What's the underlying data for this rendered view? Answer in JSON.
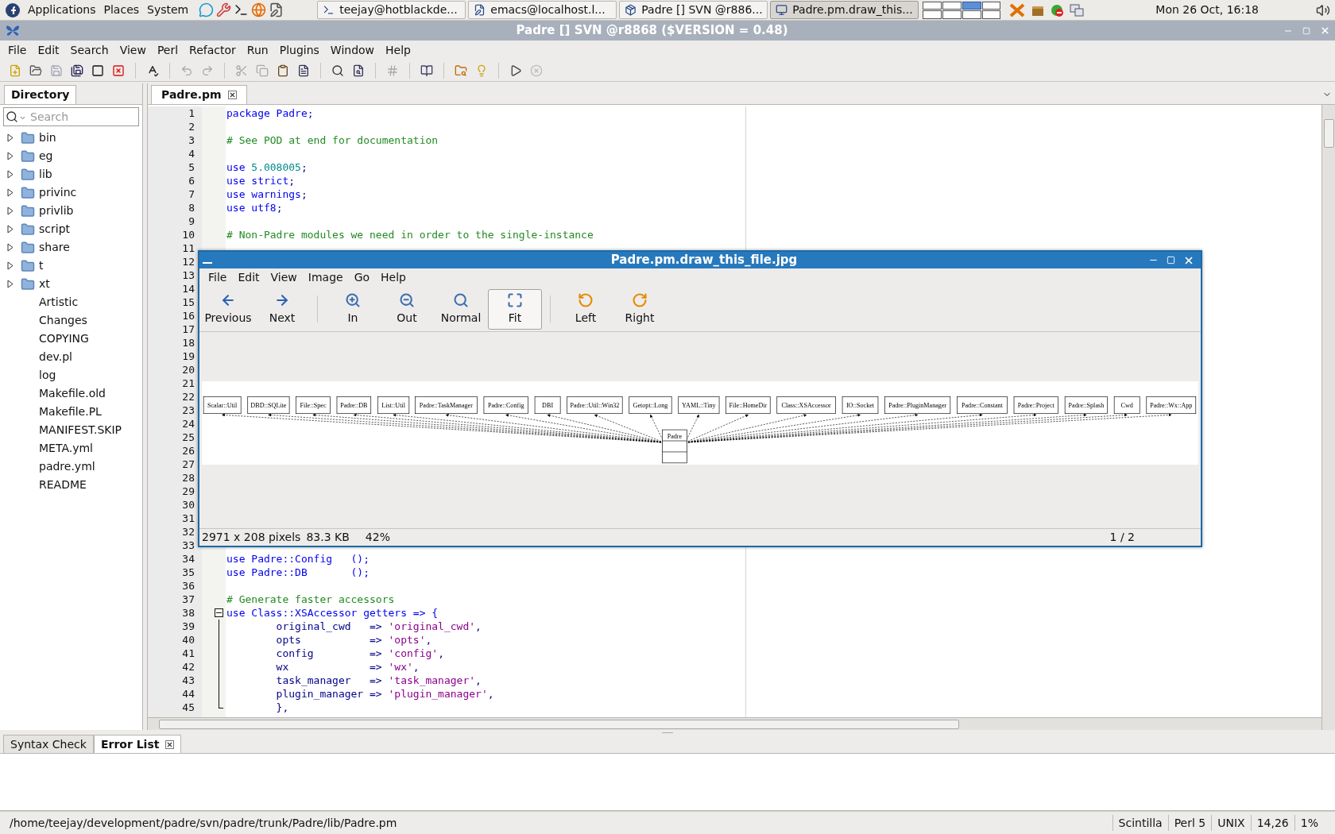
{
  "top_panel": {
    "menus": [
      "Applications",
      "Places",
      "System"
    ],
    "launchers": [
      {
        "kind": "chat"
      },
      {
        "kind": "tools"
      },
      {
        "kind": "terminal"
      },
      {
        "kind": "browser"
      },
      {
        "kind": "editor"
      }
    ],
    "tasks": [
      {
        "label": "teejay@hotblackde...",
        "kind": "terminal",
        "selected": false
      },
      {
        "label": "emacs@localhost.l...",
        "kind": "emacs",
        "selected": false
      },
      {
        "label": "Padre [] SVN @r886...",
        "kind": "padre",
        "selected": false
      },
      {
        "label": "Padre.pm.draw_this...",
        "kind": "viewer",
        "selected": true
      }
    ],
    "workspaces": [
      {
        "selected": false
      },
      {
        "selected": false
      },
      {
        "selected": true
      },
      {
        "selected": false
      },
      {
        "selected": false
      },
      {
        "selected": false
      },
      {
        "selected": false
      },
      {
        "selected": false
      }
    ],
    "clock": "Mon 26 Oct, 16:18"
  },
  "window": {
    "title": "Padre [] SVN @r8868 ($VERSION = 0.48)"
  },
  "menu": [
    "File",
    "Edit",
    "Search",
    "View",
    "Perl",
    "Refactor",
    "Run",
    "Plugins",
    "Window",
    "Help"
  ],
  "toolbar": [
    {
      "kind": "new",
      "disabled": false
    },
    {
      "kind": "open",
      "disabled": false
    },
    {
      "kind": "save",
      "disabled": true
    },
    {
      "kind": "save_as",
      "disabled": false
    },
    {
      "kind": "close_all",
      "disabled": false
    },
    {
      "kind": "close",
      "disabled": false
    },
    {
      "kind": "separator"
    },
    {
      "kind": "spell",
      "disabled": false
    },
    {
      "kind": "separator"
    },
    {
      "kind": "undo",
      "disabled": true
    },
    {
      "kind": "redo",
      "disabled": true
    },
    {
      "kind": "separator"
    },
    {
      "kind": "cut",
      "disabled": true
    },
    {
      "kind": "copy",
      "disabled": true
    },
    {
      "kind": "paste",
      "disabled": false
    },
    {
      "kind": "select_all",
      "disabled": false
    },
    {
      "kind": "separator"
    },
    {
      "kind": "find",
      "disabled": false
    },
    {
      "kind": "replace",
      "disabled": false
    },
    {
      "kind": "separator"
    },
    {
      "kind": "comment",
      "disabled": true
    },
    {
      "kind": "separator"
    },
    {
      "kind": "docs",
      "disabled": false
    },
    {
      "kind": "separator"
    },
    {
      "kind": "resource",
      "disabled": false
    },
    {
      "kind": "tip",
      "disabled": false
    },
    {
      "kind": "separator"
    },
    {
      "kind": "run",
      "disabled": false
    },
    {
      "kind": "stop",
      "disabled": true
    }
  ],
  "sidebar": {
    "tab": "Directory",
    "search": {
      "placeholder": "Search"
    },
    "items": [
      {
        "name": "bin",
        "kind": "folder"
      },
      {
        "name": "eg",
        "kind": "folder"
      },
      {
        "name": "lib",
        "kind": "folder"
      },
      {
        "name": "privinc",
        "kind": "folder"
      },
      {
        "name": "privlib",
        "kind": "folder"
      },
      {
        "name": "script",
        "kind": "folder"
      },
      {
        "name": "share",
        "kind": "folder"
      },
      {
        "name": "t",
        "kind": "folder"
      },
      {
        "name": "xt",
        "kind": "folder"
      },
      {
        "name": "Artistic",
        "kind": "file"
      },
      {
        "name": "Changes",
        "kind": "file"
      },
      {
        "name": "COPYING",
        "kind": "file"
      },
      {
        "name": "dev.pl",
        "kind": "file"
      },
      {
        "name": "log",
        "kind": "file"
      },
      {
        "name": "Makefile.old",
        "kind": "file"
      },
      {
        "name": "Makefile.PL",
        "kind": "file"
      },
      {
        "name": "MANIFEST.SKIP",
        "kind": "file"
      },
      {
        "name": "META.yml",
        "kind": "file"
      },
      {
        "name": "padre.yml",
        "kind": "file"
      },
      {
        "name": "README",
        "kind": "file"
      }
    ]
  },
  "editor": {
    "tabs": [
      {
        "label": "Padre.pm",
        "selected": true
      }
    ],
    "lines": [
      {
        "number": "1",
        "tokens": [
          {
            "kind": "kw",
            "text": "package Padre;"
          }
        ]
      },
      {
        "number": "2"
      },
      {
        "number": "3",
        "tokens": [
          {
            "kind": "comment",
            "text": "# See POD at end for documentation"
          }
        ]
      },
      {
        "number": "4"
      },
      {
        "number": "5",
        "tokens": [
          {
            "kind": "kw",
            "text": "use "
          },
          {
            "kind": "num",
            "text": "5.008005"
          },
          {
            "kind": "plain",
            "text": ";"
          }
        ]
      },
      {
        "number": "6",
        "tokens": [
          {
            "kind": "kw",
            "text": "use strict"
          },
          {
            "kind": "plain",
            "text": ";"
          }
        ]
      },
      {
        "number": "7",
        "tokens": [
          {
            "kind": "kw",
            "text": "use warnings"
          },
          {
            "kind": "plain",
            "text": ";"
          }
        ]
      },
      {
        "number": "8",
        "tokens": [
          {
            "kind": "kw",
            "text": "use utf8"
          },
          {
            "kind": "plain",
            "text": ";"
          }
        ]
      },
      {
        "number": "9"
      },
      {
        "number": "10",
        "tokens": [
          {
            "kind": "comment",
            "text": "# Non-Padre modules we need in order to the single-instance"
          }
        ]
      },
      {
        "number": "11"
      },
      {
        "number": "12"
      },
      {
        "number": "13"
      },
      {
        "number": "14"
      },
      {
        "number": "15"
      },
      {
        "number": "16"
      },
      {
        "number": "17"
      },
      {
        "number": "18"
      },
      {
        "number": "19"
      },
      {
        "number": "20"
      },
      {
        "number": "21"
      },
      {
        "number": "22"
      },
      {
        "number": "23"
      },
      {
        "number": "24"
      },
      {
        "number": "25"
      },
      {
        "number": "26"
      },
      {
        "number": "27"
      },
      {
        "number": "28"
      },
      {
        "number": "29"
      },
      {
        "number": "30"
      },
      {
        "number": "31"
      },
      {
        "number": "32"
      },
      {
        "number": "33"
      },
      {
        "number": "34",
        "tokens": [
          {
            "kind": "kw",
            "text": "use Padre::Config   ();"
          }
        ]
      },
      {
        "number": "35",
        "tokens": [
          {
            "kind": "kw",
            "text": "use Padre::DB       ();"
          }
        ]
      },
      {
        "number": "36"
      },
      {
        "number": "37",
        "tokens": [
          {
            "kind": "comment",
            "text": "# Generate faster accessors"
          }
        ]
      },
      {
        "number": "38",
        "kind": "fold_start",
        "tokens": [
          {
            "kind": "kw",
            "text": "use Class::XSAccessor getters => {"
          }
        ]
      },
      {
        "number": "39",
        "kind": "fold_line",
        "tokens": [
          {
            "kind": "plain",
            "text": "        original_cwd   => "
          },
          {
            "kind": "str",
            "text": "'original_cwd'"
          },
          {
            "kind": "plain",
            "text": ","
          }
        ]
      },
      {
        "number": "40",
        "kind": "fold_line",
        "tokens": [
          {
            "kind": "plain",
            "text": "        opts           => "
          },
          {
            "kind": "str",
            "text": "'opts'"
          },
          {
            "kind": "plain",
            "text": ","
          }
        ]
      },
      {
        "number": "41",
        "kind": "fold_line",
        "tokens": [
          {
            "kind": "plain",
            "text": "        config         => "
          },
          {
            "kind": "str",
            "text": "'config'"
          },
          {
            "kind": "plain",
            "text": ","
          }
        ]
      },
      {
        "number": "42",
        "kind": "fold_line",
        "tokens": [
          {
            "kind": "plain",
            "text": "        wx             => "
          },
          {
            "kind": "str",
            "text": "'wx'"
          },
          {
            "kind": "plain",
            "text": ","
          }
        ]
      },
      {
        "number": "43",
        "kind": "fold_line",
        "tokens": [
          {
            "kind": "plain",
            "text": "        task_manager   => "
          },
          {
            "kind": "str",
            "text": "'task_manager'"
          },
          {
            "kind": "plain",
            "text": ","
          }
        ]
      },
      {
        "number": "44",
        "kind": "fold_line",
        "tokens": [
          {
            "kind": "plain",
            "text": "        plugin_manager => "
          },
          {
            "kind": "str",
            "text": "'plugin_manager'"
          },
          {
            "kind": "plain",
            "text": ","
          }
        ]
      },
      {
        "number": "45",
        "kind": "fold_end",
        "tokens": [
          {
            "kind": "plain",
            "text": "        },"
          }
        ]
      }
    ]
  },
  "viewer": {
    "title": "Padre.pm.draw_this_file.jpg",
    "menu": [
      "File",
      "Edit",
      "View",
      "Image",
      "Go",
      "Help"
    ],
    "toolbar": [
      {
        "label": "Previous",
        "kind": "previous",
        "selected": false
      },
      {
        "label": "Next",
        "kind": "next",
        "selected": false
      },
      {
        "kind": "separator"
      },
      {
        "label": "In",
        "kind": "zoom_in",
        "selected": false
      },
      {
        "label": "Out",
        "kind": "zoom_out",
        "selected": false
      },
      {
        "label": "Normal",
        "kind": "normal",
        "selected": false
      },
      {
        "label": "Fit",
        "kind": "fit",
        "selected": true
      },
      {
        "kind": "separator"
      },
      {
        "label": "Left",
        "kind": "rotate_left",
        "selected": false
      },
      {
        "label": "Right",
        "kind": "rotate_right",
        "selected": false
      }
    ],
    "diagram": {
      "root": "Padre",
      "nodes": [
        "Scalar::Util",
        "DBD::SQLite",
        "File::Spec",
        "Padre::DB",
        "List::Util",
        "Padre::TaskManager",
        "Padre::Config",
        "DBI",
        "Padre::Util::Win32",
        "Getopt::Long",
        "YAML::Tiny",
        "File::HomeDir",
        "Class::XSAccessor",
        "IO::Socket",
        "Padre::PluginManager",
        "Padre::Constant",
        "Padre::Project",
        "Padre::Splash",
        "Cwd",
        "Padre::Wx::App"
      ]
    },
    "status": {
      "size": "2971 x 208 pixels",
      "file_size": "83.3 KB",
      "zoom": "42%",
      "page": "1 / 2"
    }
  },
  "bottom_panel": {
    "tabs": [
      {
        "label": "Syntax Check",
        "selected": false
      },
      {
        "label": "Error List",
        "selected": true
      }
    ]
  },
  "status_bar": {
    "path": "/home/teejay/development/padre/svn/padre/trunk/Padre/lib/Padre.pm",
    "fields": [
      "Scintilla",
      "Perl 5",
      "UNIX",
      "14,26",
      "1%"
    ]
  }
}
